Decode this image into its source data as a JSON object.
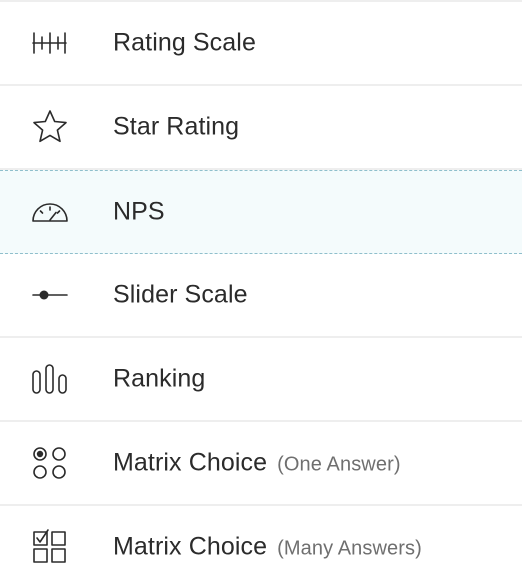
{
  "question_types": [
    {
      "label": "Rating Scale",
      "sublabel": "",
      "icon": "rating-scale-icon"
    },
    {
      "label": "Star Rating",
      "sublabel": "",
      "icon": "star-icon"
    },
    {
      "label": "NPS",
      "sublabel": "",
      "icon": "gauge-icon",
      "highlighted": true
    },
    {
      "label": "Slider Scale",
      "sublabel": "",
      "icon": "slider-icon"
    },
    {
      "label": "Ranking",
      "sublabel": "",
      "icon": "ranking-icon"
    },
    {
      "label": "Matrix Choice",
      "sublabel": "(One Answer)",
      "icon": "radio-grid-icon"
    },
    {
      "label": "Matrix Choice",
      "sublabel": "(Many Answers)",
      "icon": "checkbox-grid-icon"
    }
  ],
  "colors": {
    "text": "#2b2b2b",
    "subtext": "#6f6f6f",
    "divider": "#eeeeee",
    "highlight_bg": "#f4fbfc",
    "highlight_border": "#8fbfcc"
  }
}
